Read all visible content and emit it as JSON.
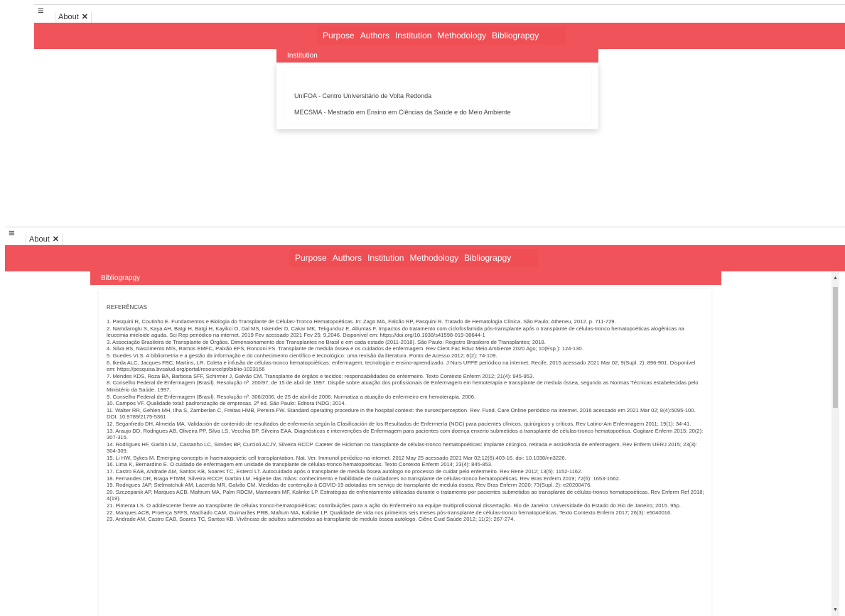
{
  "panel1": {
    "tab_label": "About",
    "nav": [
      "Purpose",
      "Authors",
      "Institution",
      "Methodology",
      "Bibliograpgy"
    ],
    "section_title": "Institution",
    "institutions": [
      "UniFOA - Centro Universitário de Volta Redonda",
      "MECSMA - Mestrado em Ensino em Ciências da Saúde e do Meio Ambiente"
    ]
  },
  "panel2": {
    "tab_label": "About",
    "nav": [
      "Purpose",
      "Authors",
      "Institution",
      "Methodology",
      "Bibliograpgy"
    ],
    "section_title": "Bibliograpgy",
    "refs_heading": "REFERÊNCIAS",
    "references": [
      "1. Pasquini R, Coutinho E. Fundamentos e Biologia do Transplante de Células-Tronco Hematopoéticas. In: Zago MA, Falcão RP, Pasquini R. Tratado de Hematologia Clínica. São Paulo; Atheneu, 2012. p. 711-729.",
      "2. Namdaroglu S, Kaya AH, Batgi H, Batgi H, Kayikci O, Dal MS, Iskender D, Cakar MK, Tekgunduz E, Altuntas F. Impactos do tratamento com ciclofosfamida pós-transplante após o transplante de células-tronco hematopoéticas alogênicas na leucemia mieloide aguda. Sci Rep periódico na internet. 2019 Fev acessado 2021 Fev 25; 9,2046. Disponível em: https://doi.org/10.1038/s41598-019-38644-1",
      "3. Associação Brasileira de Transplante de Órgãos. Dimensionamento dos Transplantes no Brasil e em cada estado (2011-2018). São Paulo: Registro Brasileiro de Transplantes; 2018.",
      "4. Silva BS, Nascimento MIS, Ramos EMFC, Paixão EFS, Ronconi FS. Transplante de medula óssea e os cuidados de enfermagem. Rev Cient Fac Educ Meio Ambiente 2020 Ago; 10(Esp.): 124-130.",
      "5. Guedes VLS. A bibliometria e a gestão da informação e do conhecimento científico e tecnológico: uma revisão da literatura. Ponto de Acesso 2012; 6(2): 74-109.",
      "6. Ikeda ALC, Jacques FBC, Martins, LR. Coleta e infusão de células-tronco hematopoiéticas: enfermagem, tecnologia e ensino-aprendizado. J Nurs UFPE periódico na internet, Recife, 2015 acessado 2021 Mar 02; 9(Supl. 2): 896-901. Disponível em: https://pesquisa.bvsalud.org/portal/resource/pt/biblio-1023166",
      "7. Mendes KDS, Roza BA, Barbosa SFF, Schirmer J, Galvão CM. Transplante de órgãos e tecidos: responsabilidades do enfermeiro. Texto Contexto Enferm 2012; 21(4): 945-953.",
      "8. Conselho Federal de Enfermagem (Brasil). Resolução nº. 200/97, de 15 de abril de 1997. Dispõe sobre atuação dos profissionais de Enfermagem em hemoterapia e transplante de medula óssea, segundo as Normas Técnicas estabelecidas pelo Ministério da Saúde. 1997.",
      "9. Conselho Federal de Enfermagem (Brasil). Resolução nº. 306/2006, de 25 de abril de 2006. Normatiza a atuação do enfermeiro em hemoterapia. 2006.",
      "10. Campos VF. Qualidade total: padronização de empresas. 2ª ed. São Paulo: Editora INDG; 2014.",
      "11. Walter RR, Gehlen MH, Ilha S, Zamberlan C, Freitas HMB, Pereira FW. Standard operating procedure in the hospital context: the nurses'perception. Rev. Fund. Care Online periódico na internet. 2016 acessado em 2021 Mar 02; 8(4):5095-100. DOI: 10.9789/2175-5361",
      "12. Seganfredo DH, Almeida MA. Validación de contenido de resultados de enfermería según la Clasificación de los Resultados de Enfermería (NOC) para pacientes clínicos, quirúrgicos y críticos. Rev Latino-Am Enfermagem 2011; 19(1): 34-41.",
      "13. Araujo DD, Rodrigues AB, Oliveira PP, Silva LS, Vecchia BP, Silveira EAA. Diagnósticos e intervenções de Enfermagem para pacientes com doença enxerto submetidos a transplante de células-tronco hematopoética. Cogitare Enferm 2015; 20(2): 307-315.",
      "14. Rodrigues HF, Garbin LM, Castanho LC, Simões BP, Curcioli ACJV, Silveira RCCP. Cateter de Hickman no transplante de células-tronco hematopoéticas: implante cirúrgico, retirada e assistência de enfermagem. Rev Enferm UERJ 2015; 23(3): 304-309.",
      "15. Li HW, Sykes M. Emerging concepts in haematopoietic cell transplantation. Nat. Ver. Immunol periódico na internet. 2012 May 25 acessado 2021 Mar 02;12(6):403-16. doi: 10.1038/nri3226.",
      "16. Lima K, Bernardino E. O cuidado de enfermagem em unidade de transplante de células-tronco hematopoéticas. Texto Contexto Enferm 2014; 23(4): 845-853.",
      "17. Castro EAB, Andrade AM, Santos KB, Soares TC, Esterci LT. Autocuidado após o transplante de medula óssea autólogo no processo de cuidar pelo enfermeiro. Rev Rene 2012; 13(5): 1152-1162.",
      "18. Fernandes DR, Braga FTMM, Silveira RCCP, Garbin LM. Higiene das mãos: conhecimento e habilidade de cuidadores no transplante de células-tronco hematopoéticas. Rev Bras Enferm 2019; 72(6): 1653-1662.",
      "19. Rodrigues JAP, Stelmatchuk AM, Lacerda MR, Galvão CM. Medidas de contenção à COVID-19 adotadas em serviço de transplante de medula óssea. Rev Bras Enferm 2020; 73(Supl. 2): e20200476.",
      "20. Szczepanik AP, Marques ACB, Maftrum MA, Palm RDCM, Mantovani MF, Kalinke LP. Estratégias de enfrentamento utilizadas durante o tratamento por pacientes submetidos ao transplante de células-tronco hematopoéticas. Rev Enferm Ref 2018; 4(19).",
      "21. Pimenta LS. O adolescente frente ao transplante de células tronco-hematopoiéticas: contribuições para a ação do Enfermeiro na equipe multiprofissional dissertação. Rio de Janeiro: Universidade do Estado do Rio de Janeiro; 2015. 95p.",
      "22. Marques ACB, Proença SFFS, Machado CAM, Guimarães PRB, Maftum MA, Kalinke LP. Qualidade de vida nos primeiros seis meses pós-transplante de células-tronco hematopoéticas. Texto Contexto Enferm 2017; 26(3): e5040016.",
      "23. Andrade AM, Castro EAB, Soares TC, Santos KB. Vivências de adultos submetidos ao transplante de medula óssea autólogo. Ciênc Cuid Saúde 2012; 11(2): 267-274."
    ]
  }
}
